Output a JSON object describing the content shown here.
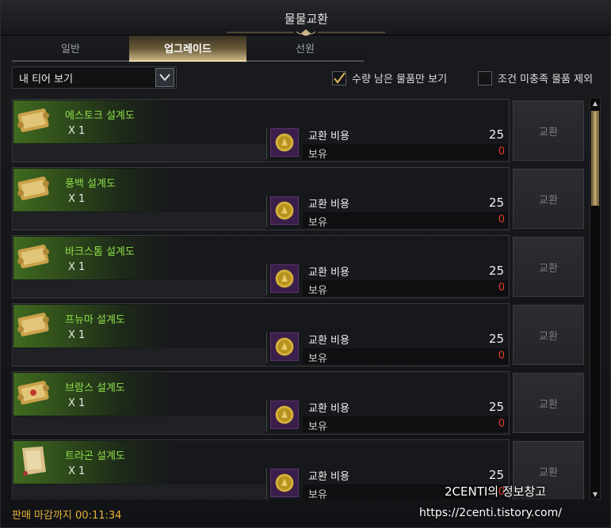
{
  "window": {
    "title": "물물교환"
  },
  "tabs": [
    {
      "label": "일반",
      "active": false
    },
    {
      "label": "업그레이드",
      "active": true
    },
    {
      "label": "선원",
      "active": false
    }
  ],
  "dropdown": {
    "value": "내 티어 보기"
  },
  "filters": [
    {
      "label": "수량 남은 물품만 보기",
      "checked": true
    },
    {
      "label": "조건 미충족 물품 제외",
      "checked": false
    }
  ],
  "items": [
    {
      "name": "에스토크 설계도",
      "qty": "X 1",
      "cost_label": "교환 비용",
      "cost": "25",
      "owned_label": "보유",
      "owned": "0",
      "button": "교환",
      "icon": "blueprint-scroll-icon"
    },
    {
      "name": "풍백 설계도",
      "qty": "X 1",
      "cost_label": "교환 비용",
      "cost": "25",
      "owned_label": "보유",
      "owned": "0",
      "button": "교환",
      "icon": "blueprint-scroll-icon"
    },
    {
      "name": "바크스톰 설계도",
      "qty": "X 1",
      "cost_label": "교환 비용",
      "cost": "25",
      "owned_label": "보유",
      "owned": "0",
      "button": "교환",
      "icon": "blueprint-scroll-icon"
    },
    {
      "name": "프뉴마 설계도",
      "qty": "X 1",
      "cost_label": "교환 비용",
      "cost": "25",
      "owned_label": "보유",
      "owned": "0",
      "button": "교환",
      "icon": "blueprint-scroll-icon"
    },
    {
      "name": "브람스 설계도",
      "qty": "X 1",
      "cost_label": "교환 비용",
      "cost": "25",
      "owned_label": "보유",
      "owned": "0",
      "button": "교환",
      "icon": "blueprint-scroll-icon"
    },
    {
      "name": "트라곤 설계도",
      "qty": "X 1",
      "cost_label": "교환 비용",
      "cost": "25",
      "owned_label": "보유",
      "owned": "0",
      "button": "교환",
      "icon": "parchment-scroll-icon"
    }
  ],
  "footer": {
    "timer": "판매 마감까지 00:11:34"
  },
  "watermark": {
    "text": "2CENTI의 정보창고",
    "url": "https://2centi.tistory.com/"
  },
  "colors": {
    "accent_gold": "#c9b486",
    "item_name_green": "#8fe04a",
    "owned_red": "#e43b2c",
    "timer_orange": "#e8b43a"
  }
}
